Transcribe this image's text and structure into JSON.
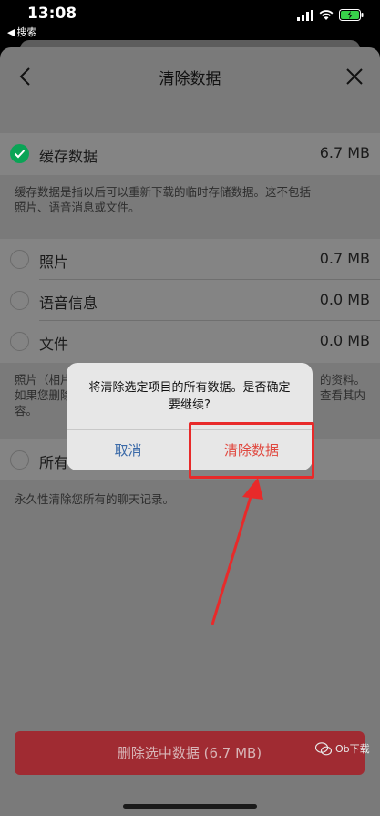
{
  "status": {
    "time": "13:08",
    "back_label": "搜索"
  },
  "nav": {
    "title": "清除数据"
  },
  "cache": {
    "label": "缓存数据",
    "value": "6.7 MB",
    "checked": true,
    "desc_line1": "缓存数据是指以后可以重新下载的临时存储数据。这不包括",
    "desc_line2": "照片、语音消息或文件。"
  },
  "items": [
    {
      "label": "照片",
      "value": "0.7 MB"
    },
    {
      "label": "语音信息",
      "value": "0.0 MB"
    },
    {
      "label": "文件",
      "value": "0.0 MB"
    }
  ],
  "media_desc": {
    "l1_left": "照片（相片",
    "l1_right": "的资料。",
    "l2_left": "如果您删除",
    "l2_right": "查看其内",
    "l3": "容。"
  },
  "all": {
    "label": "所有",
    "desc": "永久性清除您所有的聊天记录。"
  },
  "dialog": {
    "message_line1": "将清除选定项目的所有数据。是否确定",
    "message_line2": "要继续?",
    "cancel": "取消",
    "confirm": "清除数据"
  },
  "primary_button": "删除选中数据 (6.7 MB)",
  "watermark": "Ob下载",
  "colors": {
    "accent_green": "#0aa456",
    "destructive_red": "#e0483f",
    "annotation_red": "#e82a2a"
  }
}
